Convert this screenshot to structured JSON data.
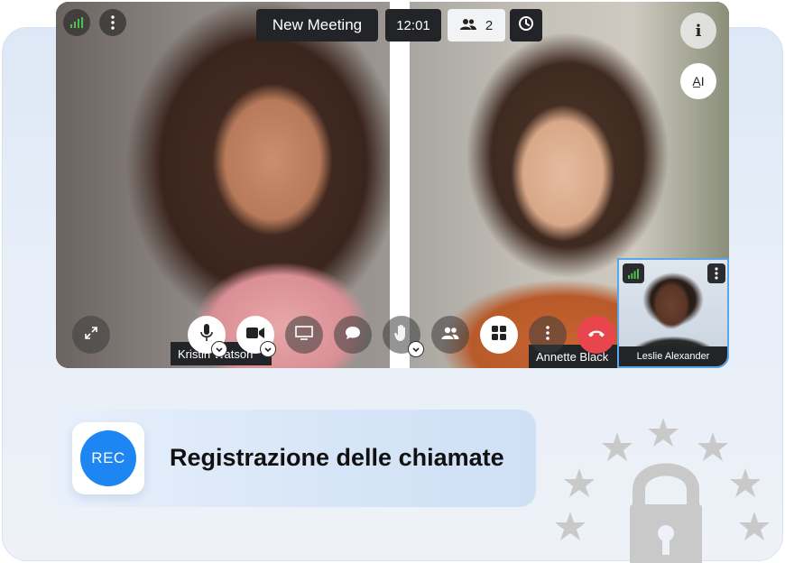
{
  "meeting": {
    "title": "New Meeting",
    "time": "12:01",
    "participants_count": "2"
  },
  "side_buttons": {
    "info_label": "i",
    "text_label": "A̲I"
  },
  "participants": [
    {
      "name": "Kristin Watson"
    },
    {
      "name": "Annette Black"
    },
    {
      "name": "Leslie Alexander"
    }
  ],
  "controls": [
    {
      "icon": "expand-icon"
    },
    {
      "icon": "microphone-icon"
    },
    {
      "icon": "camera-icon"
    },
    {
      "icon": "screen-share-icon"
    },
    {
      "icon": "chat-icon"
    },
    {
      "icon": "raise-hand-icon"
    },
    {
      "icon": "participants-icon"
    },
    {
      "icon": "layout-grid-icon"
    },
    {
      "icon": "more-options-icon"
    },
    {
      "icon": "end-call-icon"
    }
  ],
  "feature": {
    "badge": "REC",
    "title": "Registrazione delle chiamate"
  },
  "colors": {
    "accent_blue": "#1e86f2",
    "end_call_red": "#e8454c",
    "signal_green": "#4cc24a",
    "dark_chip": "#222427",
    "decor_gray": "#c9c9c9"
  }
}
